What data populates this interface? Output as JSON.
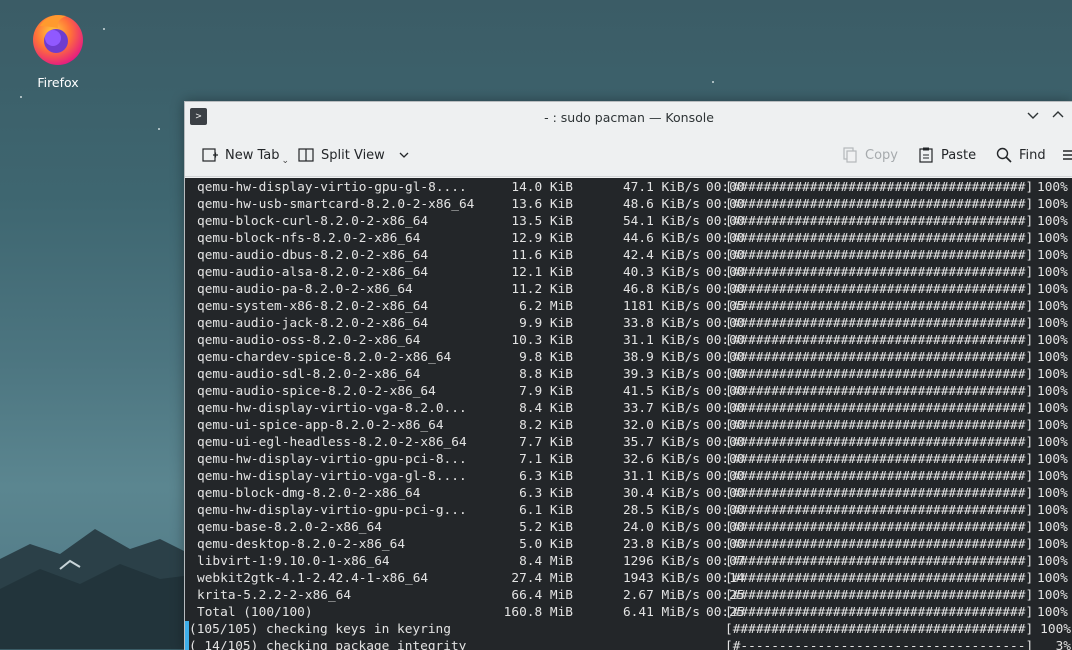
{
  "desktop": {
    "icons": [
      {
        "label": "Firefox",
        "icon": "firefox-icon"
      }
    ]
  },
  "window": {
    "title": "- : sudo pacman — Konsole",
    "app_icon": "terminal-icon",
    "controls": {
      "minimize": "chevron-down-icon",
      "maximize": "chevron-up-icon"
    }
  },
  "toolbar": {
    "new_tab": "New Tab",
    "split_view": "Split View",
    "copy": "Copy",
    "paste": "Paste",
    "find": "Find"
  },
  "terminal": {
    "lines": [
      {
        "name": "qemu-hw-display-virtio-gpu-gl-8....",
        "size": "14.0 KiB",
        "speed": "47.1 KiB/s",
        "time": "00:00",
        "bar": "[######################################]",
        "pct": "100%"
      },
      {
        "name": "qemu-hw-usb-smartcard-8.2.0-2-x86_64",
        "size": "13.6 KiB",
        "speed": "48.6 KiB/s",
        "time": "00:00",
        "bar": "[######################################]",
        "pct": "100%"
      },
      {
        "name": "qemu-block-curl-8.2.0-2-x86_64",
        "size": "13.5 KiB",
        "speed": "54.1 KiB/s",
        "time": "00:00",
        "bar": "[######################################]",
        "pct": "100%"
      },
      {
        "name": "qemu-block-nfs-8.2.0-2-x86_64",
        "size": "12.9 KiB",
        "speed": "44.6 KiB/s",
        "time": "00:00",
        "bar": "[######################################]",
        "pct": "100%"
      },
      {
        "name": "qemu-audio-dbus-8.2.0-2-x86_64",
        "size": "11.6 KiB",
        "speed": "42.4 KiB/s",
        "time": "00:00",
        "bar": "[######################################]",
        "pct": "100%"
      },
      {
        "name": "qemu-audio-alsa-8.2.0-2-x86_64",
        "size": "12.1 KiB",
        "speed": "40.3 KiB/s",
        "time": "00:00",
        "bar": "[######################################]",
        "pct": "100%"
      },
      {
        "name": "qemu-audio-pa-8.2.0-2-x86_64",
        "size": "11.2 KiB",
        "speed": "46.8 KiB/s",
        "time": "00:00",
        "bar": "[######################################]",
        "pct": "100%"
      },
      {
        "name": "qemu-system-x86-8.2.0-2-x86_64",
        "size": "6.2 MiB",
        "speed": "1181 KiB/s",
        "time": "00:05",
        "bar": "[######################################]",
        "pct": "100%"
      },
      {
        "name": "qemu-audio-jack-8.2.0-2-x86_64",
        "size": "9.9 KiB",
        "speed": "33.8 KiB/s",
        "time": "00:00",
        "bar": "[######################################]",
        "pct": "100%"
      },
      {
        "name": "qemu-audio-oss-8.2.0-2-x86_64",
        "size": "10.3 KiB",
        "speed": "31.1 KiB/s",
        "time": "00:00",
        "bar": "[######################################]",
        "pct": "100%"
      },
      {
        "name": "qemu-chardev-spice-8.2.0-2-x86_64",
        "size": "9.8 KiB",
        "speed": "38.9 KiB/s",
        "time": "00:00",
        "bar": "[######################################]",
        "pct": "100%"
      },
      {
        "name": "qemu-audio-sdl-8.2.0-2-x86_64",
        "size": "8.8 KiB",
        "speed": "39.3 KiB/s",
        "time": "00:00",
        "bar": "[######################################]",
        "pct": "100%"
      },
      {
        "name": "qemu-audio-spice-8.2.0-2-x86_64",
        "size": "7.9 KiB",
        "speed": "41.5 KiB/s",
        "time": "00:00",
        "bar": "[######################################]",
        "pct": "100%"
      },
      {
        "name": "qemu-hw-display-virtio-vga-8.2.0...",
        "size": "8.4 KiB",
        "speed": "33.7 KiB/s",
        "time": "00:00",
        "bar": "[######################################]",
        "pct": "100%"
      },
      {
        "name": "qemu-ui-spice-app-8.2.0-2-x86_64",
        "size": "8.2 KiB",
        "speed": "32.0 KiB/s",
        "time": "00:00",
        "bar": "[######################################]",
        "pct": "100%"
      },
      {
        "name": "qemu-ui-egl-headless-8.2.0-2-x86_64",
        "size": "7.7 KiB",
        "speed": "35.7 KiB/s",
        "time": "00:00",
        "bar": "[######################################]",
        "pct": "100%"
      },
      {
        "name": "qemu-hw-display-virtio-gpu-pci-8...",
        "size": "7.1 KiB",
        "speed": "32.6 KiB/s",
        "time": "00:00",
        "bar": "[######################################]",
        "pct": "100%"
      },
      {
        "name": "qemu-hw-display-virtio-vga-gl-8....",
        "size": "6.3 KiB",
        "speed": "31.1 KiB/s",
        "time": "00:00",
        "bar": "[######################################]",
        "pct": "100%"
      },
      {
        "name": "qemu-block-dmg-8.2.0-2-x86_64",
        "size": "6.3 KiB",
        "speed": "30.4 KiB/s",
        "time": "00:00",
        "bar": "[######################################]",
        "pct": "100%"
      },
      {
        "name": "qemu-hw-display-virtio-gpu-pci-g...",
        "size": "6.1 KiB",
        "speed": "28.5 KiB/s",
        "time": "00:00",
        "bar": "[######################################]",
        "pct": "100%"
      },
      {
        "name": "qemu-base-8.2.0-2-x86_64",
        "size": "5.2 KiB",
        "speed": "24.0 KiB/s",
        "time": "00:00",
        "bar": "[######################################]",
        "pct": "100%"
      },
      {
        "name": "qemu-desktop-8.2.0-2-x86_64",
        "size": "5.0 KiB",
        "speed": "23.8 KiB/s",
        "time": "00:00",
        "bar": "[######################################]",
        "pct": "100%"
      },
      {
        "name": "libvirt-1:9.10.0-1-x86_64",
        "size": "8.4 MiB",
        "speed": "1296 KiB/s",
        "time": "00:07",
        "bar": "[######################################]",
        "pct": "100%"
      },
      {
        "name": "webkit2gtk-4.1-2.42.4-1-x86_64",
        "size": "27.4 MiB",
        "speed": "1943 KiB/s",
        "time": "00:14",
        "bar": "[######################################]",
        "pct": "100%"
      },
      {
        "name": "krita-5.2.2-2-x86_64",
        "size": "66.4 MiB",
        "speed": "2.67 MiB/s",
        "time": "00:25",
        "bar": "[######################################]",
        "pct": "100%"
      },
      {
        "name": "Total (100/100)",
        "size": "160.8 MiB",
        "speed": "6.41 MiB/s",
        "time": "00:25",
        "bar": "[######################################]",
        "pct": "100%"
      }
    ],
    "status_lines": [
      {
        "text": "(105/105) checking keys in keyring",
        "bar": "[######################################]",
        "pct": "100%"
      },
      {
        "text": "( 14/105) checking package integrity",
        "bar": "[#-------------------------------------]",
        "pct": "3%"
      }
    ]
  }
}
